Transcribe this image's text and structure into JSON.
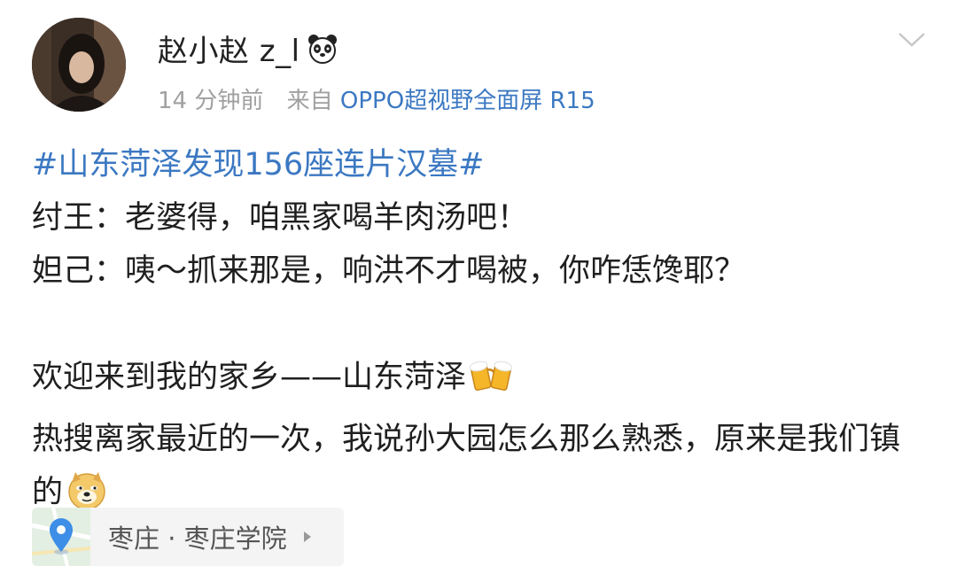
{
  "header": {
    "username": "赵小赵 z_l",
    "username_badge_icon": "panda-face-icon",
    "time": "14 分钟前",
    "from_label": "来自",
    "device": "OPPO超视野全面屏 R15",
    "expand_icon": "chevron-down-icon"
  },
  "post": {
    "hashtag": "#山东菏泽发现156座连片汉墓#",
    "line1": "纣王：老婆得，咱黑家喝羊肉汤吧！",
    "line2": "妲己：咦～抓来那是，响洪不才喝被，你咋恁馋耶？",
    "line3": "欢迎来到我的家乡——山东菏泽",
    "line3_emoji": "beer-cheers-icon",
    "line4": "热搜离家最近的一次，我说孙大园怎么那么熟悉，原来是我们镇的",
    "line4_emoji": "doge-face-icon"
  },
  "location": {
    "icon": "map-pin-icon",
    "label": "枣庄 · 枣庄学院",
    "arrow_icon": "chevron-right-icon"
  },
  "colors": {
    "link_blue": "#3b78c2",
    "meta_gray": "#a0a0a0",
    "text": "#1f1f1f",
    "location_bg": "#f4f4f4"
  }
}
